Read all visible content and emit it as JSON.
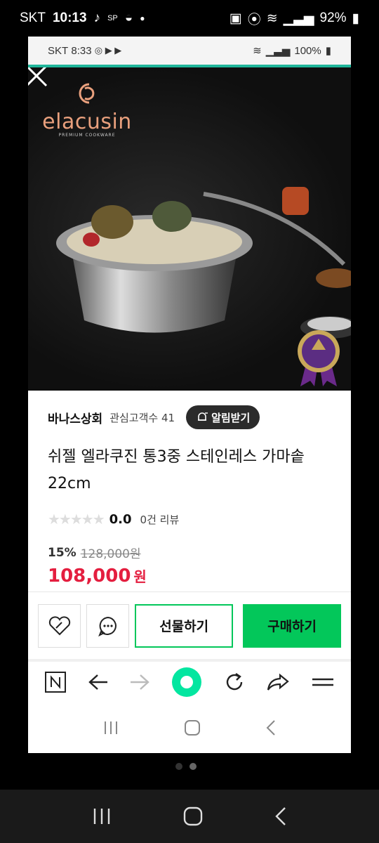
{
  "outer_status": {
    "carrier": "SKT",
    "time": "10:13",
    "battery": "92%"
  },
  "inner_status": {
    "carrier": "SKT",
    "time": "8:33",
    "battery": "100%"
  },
  "hero": {
    "logo_text": "elacusin",
    "logo_sub": "PREMIUM COOKWARE"
  },
  "store": {
    "name": "바나스상회",
    "fans": "관심고객수 41",
    "alert_label": "알림받기"
  },
  "product": {
    "title": "쉬젤 엘라쿠진 통3중 스테인레스 가마솥 22cm",
    "rating": "0.0",
    "reviews": "0건 리뷰",
    "discount": "15%",
    "original_price": "128,000원",
    "final_price": "108,000",
    "currency": "원"
  },
  "actions": {
    "gift_label": "선물하기",
    "buy_label": "구매하기"
  },
  "colors": {
    "accent": "#03c75a",
    "price": "#e41e3f",
    "teal": "#1fb59a"
  },
  "icons": [
    "close-icon",
    "heart-icon",
    "chat-icon",
    "bell-plus-icon",
    "naver-n-icon",
    "back-arrow-icon",
    "forward-arrow-icon",
    "home-circle-icon",
    "refresh-icon",
    "share-icon",
    "menu-icon"
  ]
}
